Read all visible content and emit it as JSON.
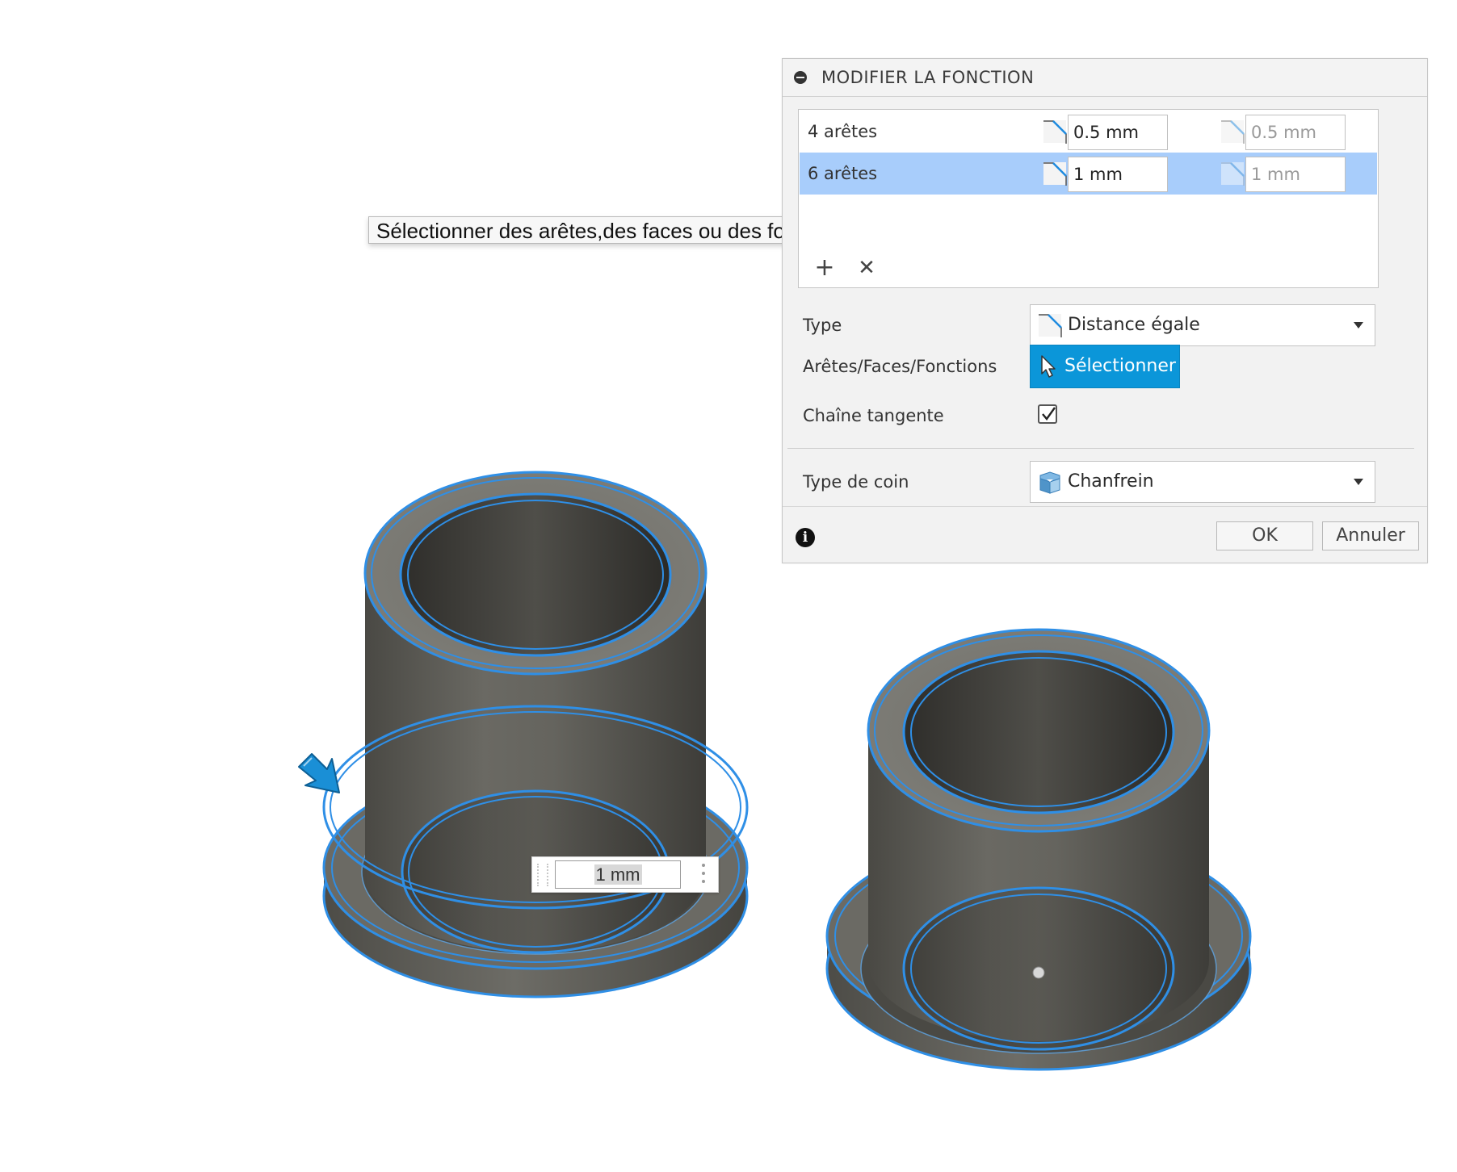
{
  "dialog": {
    "title": "MODIFIER LA FONCTION",
    "selection_sets": [
      {
        "label": "4 arêtes",
        "distance": "0.5 mm",
        "distance2": "0.5 mm",
        "selected": false
      },
      {
        "label": "6 arêtes",
        "distance": "1 mm",
        "distance2": "1 mm",
        "selected": true
      }
    ],
    "add_icon": "plus-icon",
    "remove_icon": "x-icon",
    "type_label": "Type",
    "type_value": "Distance égale",
    "edges_label": "Arêtes/Faces/Fonctions",
    "select_button": "Sélectionner",
    "tangent_chain_label": "Chaîne tangente",
    "tangent_chain_checked": true,
    "corner_type_label": "Type de coin",
    "corner_type_value": "Chanfrein",
    "ok_button": "OK",
    "cancel_button": "Annuler"
  },
  "tooltip": "Sélectionner des arêtes,des faces ou des fonctions à chanfreiner",
  "canvas_input": {
    "value": "1 mm"
  },
  "colors": {
    "accent": "#0b96d9",
    "selection_row": "#a8cdfb",
    "edge_highlight": "#2f8fe6",
    "model_body": "#5a5954"
  }
}
